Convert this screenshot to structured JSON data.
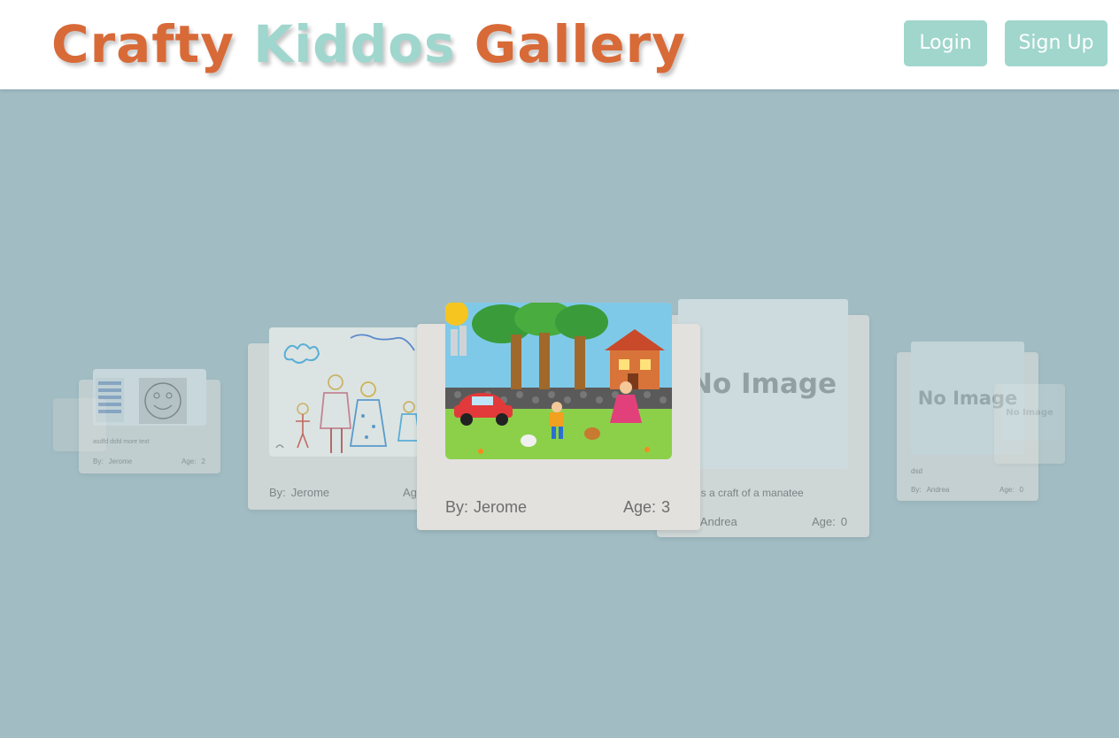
{
  "header": {
    "logo": {
      "word1": "Crafty",
      "word2": "Kiddos",
      "word3": "Gallery"
    },
    "login_label": "Login",
    "signup_label": "Sign Up"
  },
  "colors": {
    "logo_orange": "#d86a38",
    "logo_teal": "#9fd6cd",
    "button_bg": "#a0d6cc",
    "backdrop": "#a1bcc3",
    "card_bg": "#e2e1de"
  },
  "common": {
    "by_label": "By:",
    "age_label": "Age:",
    "no_image": "No Image"
  },
  "cards": {
    "far_left": {
      "description": "asdfd dsfd more text",
      "author": "Jerome",
      "age": "2"
    },
    "left": {
      "author": "Jerome",
      "age_label_partial": "Ag"
    },
    "center": {
      "author": "Jerome",
      "age": "3"
    },
    "right": {
      "description": "is a craft of a manatee",
      "author": "Andrea",
      "age": "0"
    },
    "far_right": {
      "description": "dsd",
      "author": "Andrea",
      "age": "0"
    },
    "farthest_right": {
      "text": "No Image"
    }
  }
}
